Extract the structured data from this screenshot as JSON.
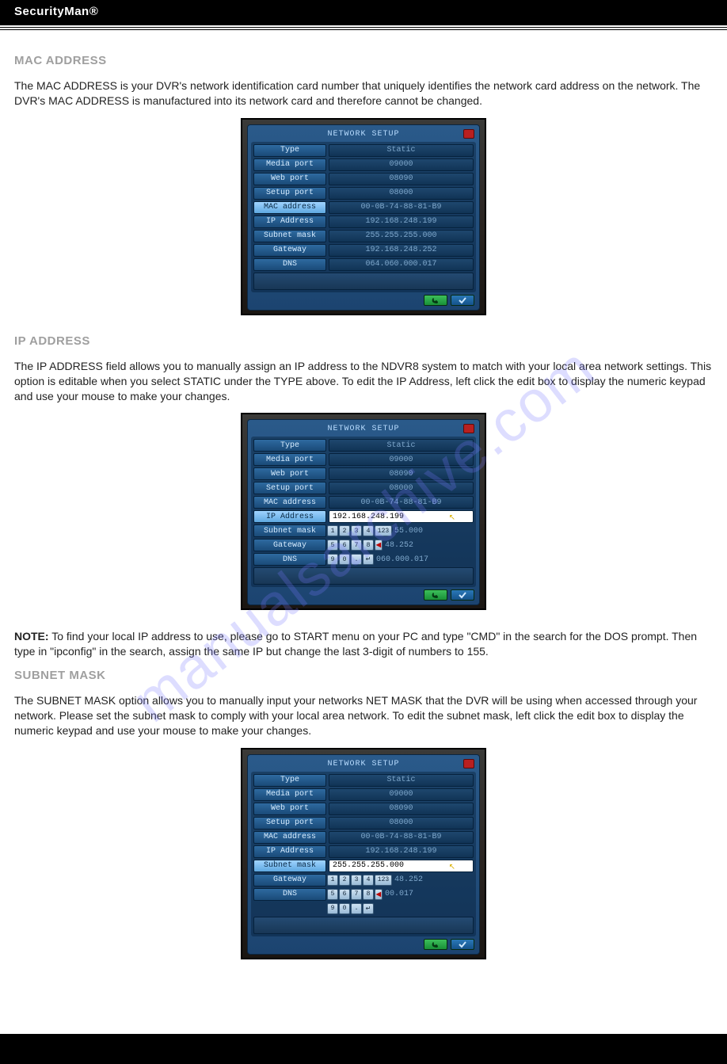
{
  "brand": "SecurityMan®",
  "watermark": "manualsarchive.com",
  "sections": {
    "mac": {
      "heading": "MAC ADDRESS",
      "text": "The MAC ADDRESS is your DVR's network identification card number that uniquely identifies the network card address on the network. The DVR's MAC ADDRESS is manufactured into its network card and therefore cannot be changed."
    },
    "ip": {
      "heading": "IP ADDRESS",
      "text": "The IP ADDRESS field allows you to manually assign an IP address to the NDVR8 system to match with your local area network settings.  This option is editable when you select STATIC under the TYPE above.  To edit the IP Address, left click the edit box to display the numeric keypad and use your mouse to make your changes."
    },
    "note": {
      "label": "NOTE:",
      "text": " To find your local IP address to use, please go to START menu on your PC and type \"CMD\" in the search for the DOS prompt.  Then type in \"ipconfig\" in the search, assign the same IP but change the last 3-digit of numbers to 155."
    },
    "subnet": {
      "heading": "SUBNET MASK",
      "text": "The SUBNET MASK option allows you to manually input your networks NET MASK that the DVR will be using when accessed through your network.  Please set the subnet mask to comply with your local area network.  To edit the subnet mask, left click the edit box to display the numeric keypad and use your mouse to make your changes."
    }
  },
  "dvr": {
    "title": "NETWORK SETUP",
    "labels": {
      "type": "Type",
      "media_port": "Media port",
      "web_port": "Web port",
      "setup_port": "Setup port",
      "mac": "MAC address",
      "ip": "IP Address",
      "subnet": "Subnet mask",
      "gateway": "Gateway",
      "dns": "DNS"
    },
    "values": {
      "type": "Static",
      "media_port": "09000",
      "web_port": "08090",
      "setup_port": "08000",
      "mac": "00-0B-74-88-81-B9",
      "ip": "192.168.248.199",
      "subnet": "255.255.255.000",
      "gateway": "192.168.248.252",
      "dns": "064.060.000.017"
    },
    "keypad": {
      "k1": "1",
      "k2": "2",
      "k3": "3",
      "k4": "4",
      "k123": "123",
      "k5": "5",
      "k6": "6",
      "k7": "7",
      "k8": "8",
      "kback": "◀",
      "k9": "9",
      "k0": "0",
      "kdot": ".",
      "kenter": "↵"
    },
    "tails": {
      "ip_row2": "55.000",
      "ip_row3": "48.252",
      "ip_row4": "060.000.017",
      "sub_row2": "48.252",
      "sub_row3": "00.017"
    },
    "edit_values": {
      "ip_edit": "192.168.248.199",
      "subnet_edit": "255.255.255.000"
    }
  }
}
